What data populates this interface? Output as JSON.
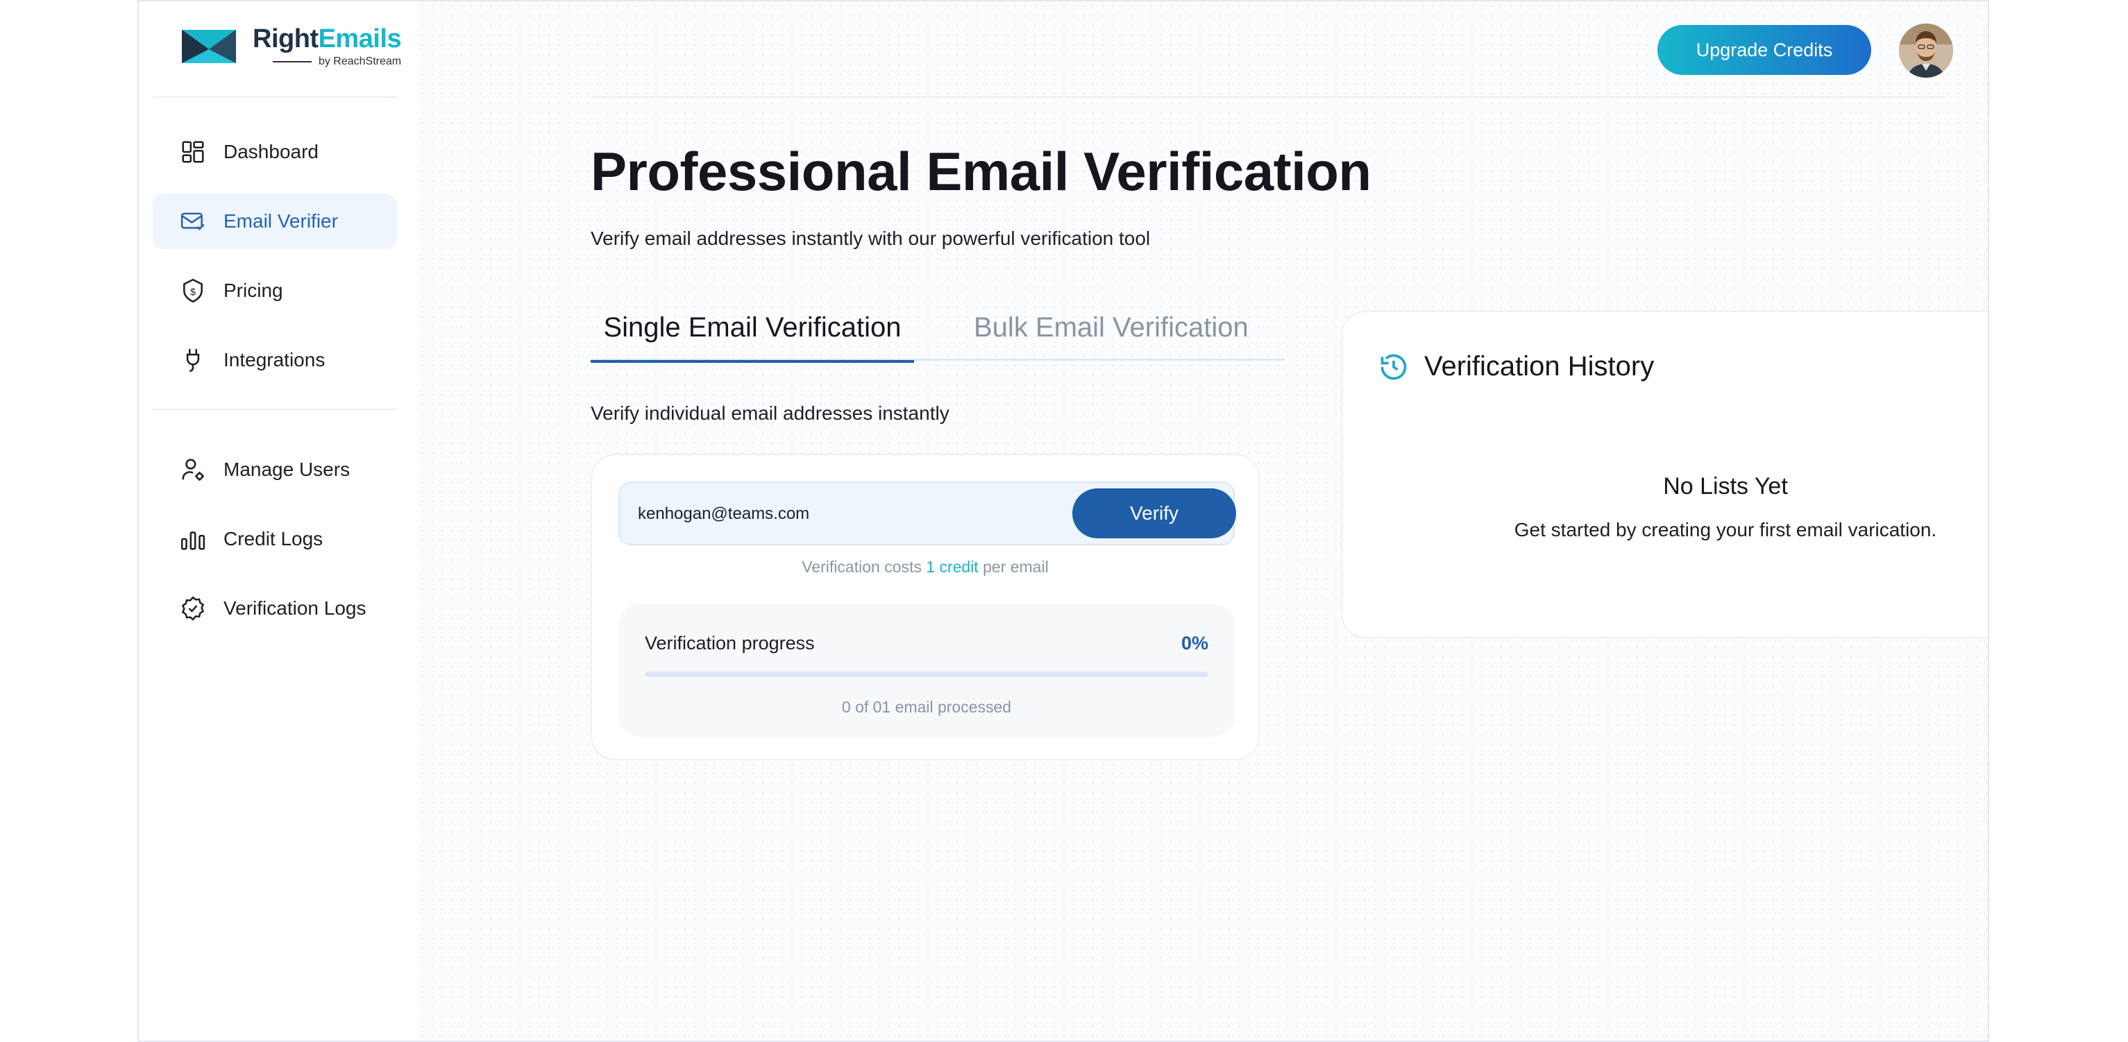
{
  "app": {
    "brand_name_part1": "Right",
    "brand_name_part2": "Emails",
    "brand_byline": "by ReachStream"
  },
  "sidebar": {
    "items": [
      {
        "label": "Dashboard",
        "icon": "dashboard-icon"
      },
      {
        "label": "Email Verifier",
        "icon": "mail-check-icon",
        "active": true
      },
      {
        "label": "Pricing",
        "icon": "price-tag-icon"
      },
      {
        "label": "Integrations",
        "icon": "plug-icon"
      }
    ],
    "secondary_items": [
      {
        "label": "Manage Users",
        "icon": "user-gear-icon"
      },
      {
        "label": "Credit Logs",
        "icon": "bar-chart-icon"
      },
      {
        "label": "Verification Logs",
        "icon": "verified-badge-icon"
      }
    ]
  },
  "header": {
    "upgrade_label": "Upgrade Credits"
  },
  "main": {
    "title": "Professional Email Verification",
    "subtitle": "Verify email addresses instantly with our powerful verification tool",
    "tabs": [
      {
        "label": "Single Email Verification",
        "active": true
      },
      {
        "label": "Bulk Email Verification",
        "active": false
      }
    ],
    "tab_description": "Verify individual email addresses instantly",
    "verify_form": {
      "email_value": "kenhogan@teams.com",
      "verify_label": "Verify",
      "cost_prefix": "Verification costs",
      "cost_credit": "1 credit",
      "cost_suffix": "per email"
    },
    "progress": {
      "label": "Verification progress",
      "percent_text": "0%",
      "percent_value": 0,
      "count_text": "0 of 01 email processed"
    }
  },
  "history": {
    "title": "Verification History",
    "empty_title": "No Lists Yet",
    "empty_description": "Get started by creating your first email varication."
  },
  "colors": {
    "primary": "#1f5ea8",
    "accent": "#17b6c9",
    "active_nav_bg": "#eef5fd",
    "muted_text": "#8b95a4"
  }
}
